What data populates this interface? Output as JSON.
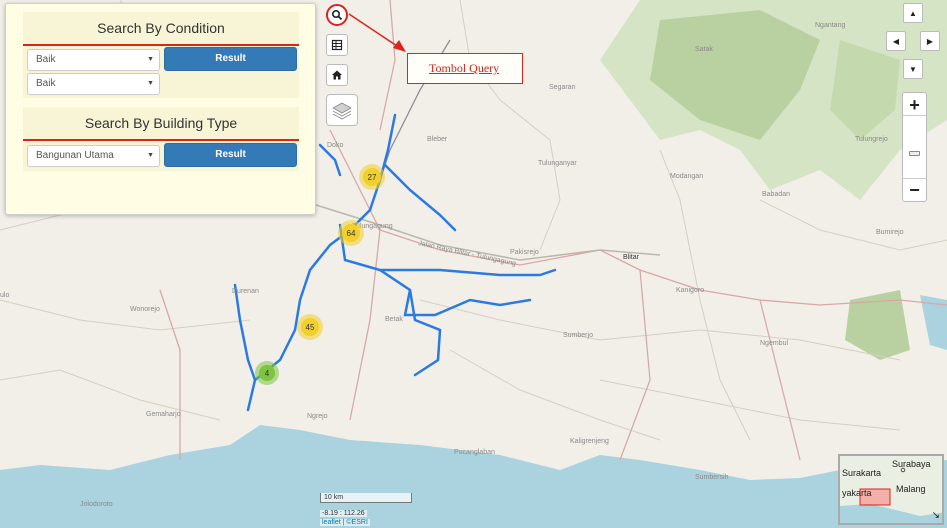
{
  "query_panel": {
    "condition": {
      "title": "Search By Condition",
      "select1": "Baik",
      "select2": "Baik",
      "button": "Result"
    },
    "building_type": {
      "title": "Search By Building Type",
      "select": "Bangunan Utama",
      "button": "Result"
    }
  },
  "annotation": {
    "text": "Tombol Query"
  },
  "clusters": [
    {
      "count": "27",
      "color": "#f2cf2a"
    },
    {
      "count": "64",
      "color": "#f2cf2a"
    },
    {
      "count": "45",
      "color": "#f2cf2a"
    },
    {
      "count": "4",
      "color": "#7dc441"
    }
  ],
  "map_labels": {
    "ngantang": "Ngantang",
    "segaran": "Segaran",
    "bleber": "Bleber",
    "doko": "Doko",
    "tulungagung": "Tulungagung",
    "tulunganyar": "Tulunganyar",
    "modangan": "Modangan",
    "babadan": "Babadan",
    "bumirejo": "Bumirejo",
    "road": "Jalan Raya Blitar - Tulungagung",
    "pakisrejo": "Pakisrejo",
    "blitar": "Blitar",
    "kanigoro": "Kanigoro",
    "durenan": "Durenan",
    "wonorejo": "Wonorejo",
    "betak": "Betak",
    "sumberjo": "Sumberjo",
    "ngembul": "Ngembul",
    "ngrejo": "Ngrejo",
    "gemaharjo": "Gemaharjo",
    "pucanglaban": "Pucanglaban",
    "kaligrenjeng": "Kaligrenjeng",
    "sumbersih": "Sumbersih",
    "jolodoroto": "Jolodoroto",
    "ulo": "ulo",
    "satak": "Satak",
    "tulungrejo": "Tulungrejo"
  },
  "scale": {
    "label": "10 km"
  },
  "coords": "-8.19 : 112.26",
  "attribution": "leaflet | ©ESRI",
  "minimap": {
    "surakarta": "Surakarta",
    "surabaya": "Surabaya",
    "yakarta": "yakarta",
    "malang": "Malang"
  },
  "icons": {
    "search": "search-icon",
    "table": "table-icon",
    "home": "home-icon",
    "layers": "layers-icon"
  },
  "colors": {
    "accent_red": "#d9251c",
    "button_blue": "#337ab7",
    "river": "#2a7ae2",
    "sea": "#aad3df"
  }
}
